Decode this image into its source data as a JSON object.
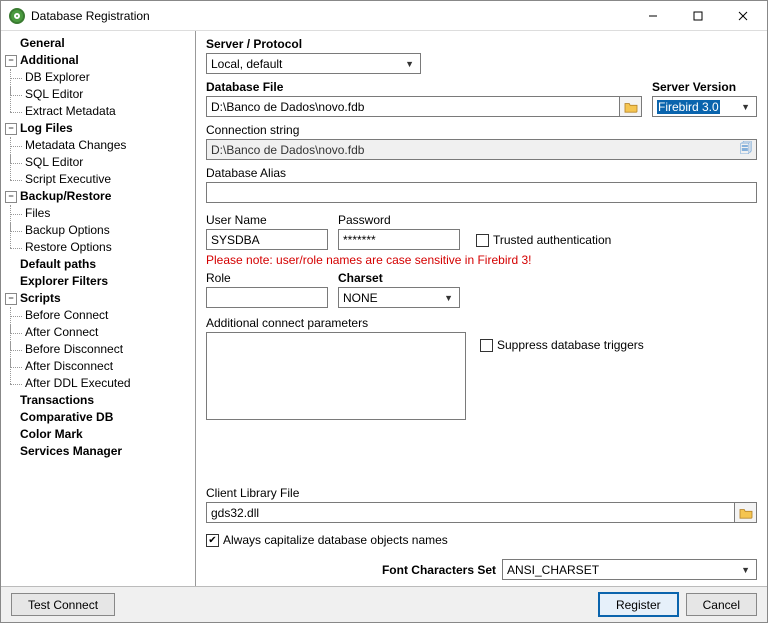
{
  "window": {
    "title": "Database Registration"
  },
  "sidebar": {
    "general": "General",
    "additional": "Additional",
    "additional_items": [
      "DB Explorer",
      "SQL Editor",
      "Extract Metadata"
    ],
    "log_files": "Log Files",
    "log_items": [
      "Metadata Changes",
      "SQL Editor",
      "Script Executive"
    ],
    "backup": "Backup/Restore",
    "backup_items": [
      "Files",
      "Backup Options",
      "Restore Options"
    ],
    "default_paths": "Default paths",
    "explorer_filters": "Explorer Filters",
    "scripts": "Scripts",
    "script_items": [
      "Before Connect",
      "After Connect",
      "Before Disconnect",
      "After Disconnect",
      "After DDL Executed"
    ],
    "transactions": "Transactions",
    "comparative": "Comparative DB",
    "color_mark": "Color Mark",
    "services": "Services Manager"
  },
  "main": {
    "server_protocol_label": "Server / Protocol",
    "server_protocol_value": "Local, default",
    "database_file_label": "Database File",
    "database_file_value": "D:\\Banco de Dados\\novo.fdb",
    "server_version_label": "Server Version",
    "server_version_value": "Firebird 3.0",
    "connection_string_label": "Connection string",
    "connection_string_value": "D:\\Banco de Dados\\novo.fdb",
    "database_alias_label": "Database Alias",
    "database_alias_value": "",
    "username_label": "User Name",
    "username_value": "SYSDBA",
    "password_label": "Password",
    "password_value": "*******",
    "trusted_auth_label": "Trusted authentication",
    "note": "Please note: user/role names are case sensitive in Firebird 3!",
    "role_label": "Role",
    "role_value": "",
    "charset_label": "Charset",
    "charset_value": "NONE",
    "additional_params_label": "Additional connect parameters",
    "suppress_triggers_label": "Suppress database triggers",
    "client_lib_label": "Client Library File",
    "client_lib_value": "gds32.dll",
    "capitalize_label": "Always capitalize database objects names",
    "font_charset_label": "Font Characters Set",
    "font_charset_value": "ANSI_CHARSET"
  },
  "footer": {
    "test_connect": "Test Connect",
    "register": "Register",
    "cancel": "Cancel"
  }
}
